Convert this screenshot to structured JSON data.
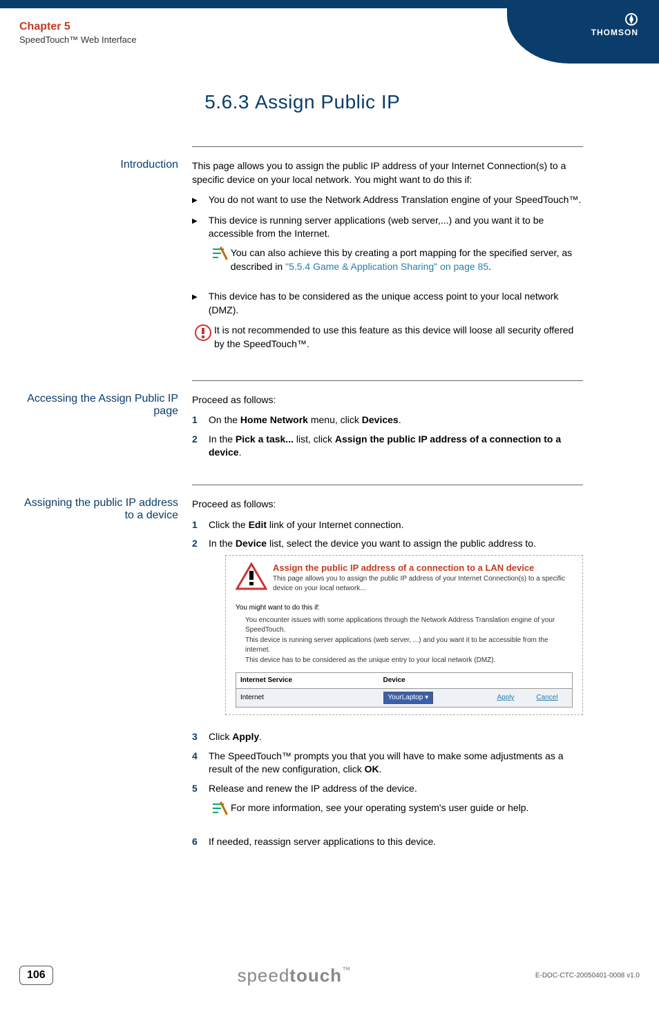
{
  "header": {
    "chapter": "Chapter 5",
    "subtitle": "SpeedTouch™ Web Interface",
    "logo": "THOMSON"
  },
  "title": {
    "number": "5.6.3",
    "text": "Assign Public IP"
  },
  "intro": {
    "label": "Introduction",
    "lead": "This page allows you to assign the public IP address of your Internet Connection(s) to a specific device on your local network. You might want to do this if:",
    "bullets": [
      "You do not want to use the Network Address Translation engine of your SpeedTouch™.",
      "This device is running server applications (web server,...) and you want it to be accessible from the Internet.",
      "This device has to be considered as the unique access point to your local network (DMZ)."
    ],
    "tip_pre": "You can also achieve this by creating a port mapping for the specified server, as described in ",
    "tip_link": "\"5.5.4 Game & Application Sharing\" on page 85",
    "tip_post": ".",
    "warn": "It is not recommended to use this feature as this device will loose all security offered by the SpeedTouch™."
  },
  "access": {
    "label": "Accessing the Assign Public IP page",
    "lead": "Proceed as follows:",
    "steps": [
      {
        "pre": "On the ",
        "b1": "Home Network",
        "mid": " menu, click ",
        "b2": "Devices",
        "post": "."
      },
      {
        "pre": "In the ",
        "b1": "Pick a task...",
        "mid": " list, click ",
        "b2": "Assign the public IP address of a connection to a device",
        "post": "."
      }
    ]
  },
  "assign": {
    "label": "Assigning the public IP address to a device",
    "lead": "Proceed as follows:",
    "step1": {
      "pre": "Click the ",
      "b": "Edit",
      "post": " link of your Internet connection."
    },
    "step2": {
      "pre": "In the ",
      "b": "Device",
      "post": " list, select the device you want to assign the public address to."
    },
    "shot": {
      "title": "Assign the public IP address of a connection to a LAN device",
      "desc": "This page allows you to assign the public IP address of your Internet Connection(s) to a specific device on your local network...",
      "sub": "You might want to do this if:",
      "list": [
        "You encounter issues with some applications through the Network Address Translation engine of your SpeedTouch.",
        "This device is running server applications (web server, ...) and you want it to be accessible from the internet.",
        "This device has to be considered as the unique entry to your local network (DMZ)."
      ],
      "th1": "Internet Service",
      "th2": "Device",
      "svc": "Internet",
      "dev": "YourLaptop",
      "apply": "Apply",
      "cancel": "Cancel"
    },
    "step3": {
      "pre": "Click ",
      "b": "Apply",
      "post": "."
    },
    "step4": {
      "pre": "The SpeedTouch™ prompts you that you will have to make some adjustments as a result of the new configuration, click ",
      "b": "OK",
      "post": "."
    },
    "step5": "Release and renew the IP address of the device.",
    "info": "For more information, see your operating system's user guide or help.",
    "step6": "If needed, reassign server applications to this device."
  },
  "footer": {
    "page": "106",
    "brand_light": "speed",
    "brand_bold": "touch",
    "doc": "E-DOC-CTC-20050401-0008 v1.0"
  }
}
